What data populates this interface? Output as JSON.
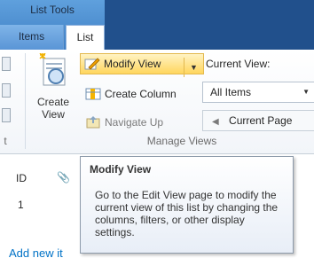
{
  "ribbon_tabs": {
    "contextual_group": "List Tools",
    "items_tab": "Items",
    "list_tab": "List"
  },
  "ribbon": {
    "create_view": "Create\nView",
    "modify_view": "Modify View",
    "create_column": "Create Column",
    "navigate_up": "Navigate Up",
    "current_view_label": "Current View:",
    "current_view_value": "All Items",
    "current_page": "Current Page",
    "group_label": "Manage Views"
  },
  "list": {
    "col_id": "ID",
    "attachment_icon": "paperclip-icon",
    "row_id": "1",
    "add_new_item": "Add new it"
  },
  "tooltip": {
    "title": "Modify View",
    "body": "Go to the Edit View page to modify the current view of this list by changing the columns, filters, or other display settings."
  },
  "colors": {
    "tab_bar": "#21508c",
    "contextual_tab": "#5fa0dd",
    "modify_highlight": "#ffd65e",
    "link": "#0072c6"
  }
}
